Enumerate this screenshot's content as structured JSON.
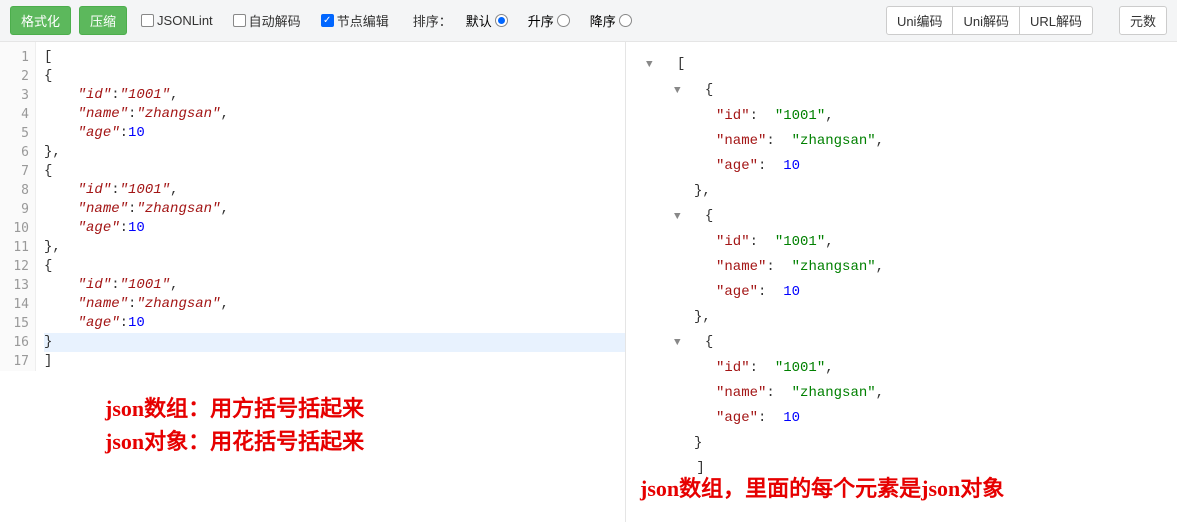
{
  "toolbar": {
    "format_btn": "格式化",
    "compress_btn": "压缩",
    "jsonlint_label": "JSONLint",
    "autodecode_label": "自动解码",
    "nodeedit_label": "节点编辑",
    "sort_label": "排序：",
    "sort_default": "默认",
    "sort_asc": "升序",
    "sort_desc": "降序",
    "uni_encode": "Uni编码",
    "uni_decode": "Uni解码",
    "url_decode": "URL解码",
    "meta_btn": "元数"
  },
  "code": {
    "lines": [
      "[",
      "{",
      "    \"id\":\"1001\",",
      "    \"name\":\"zhangsan\",",
      "    \"age\":10",
      "},",
      "{",
      "    \"id\":\"1001\",",
      "    \"name\":\"zhangsan\",",
      "    \"age\":10",
      "},",
      "{",
      "    \"id\":\"1001\",",
      "    \"name\":\"zhangsan\",",
      "    \"age\":10",
      "}",
      "]"
    ],
    "line_count": 17
  },
  "tree": {
    "objects": [
      {
        "id": "1001",
        "name": "zhangsan",
        "age": 10
      },
      {
        "id": "1001",
        "name": "zhangsan",
        "age": 10
      },
      {
        "id": "1001",
        "name": "zhangsan",
        "age": 10
      }
    ],
    "key_id": "id",
    "key_name": "name",
    "key_age": "age"
  },
  "annotations": {
    "left_line1": "json数组：用方括号括起来",
    "left_line2": "json对象：用花括号括起来",
    "right_line": "json数组，里面的每个元素是json对象"
  }
}
